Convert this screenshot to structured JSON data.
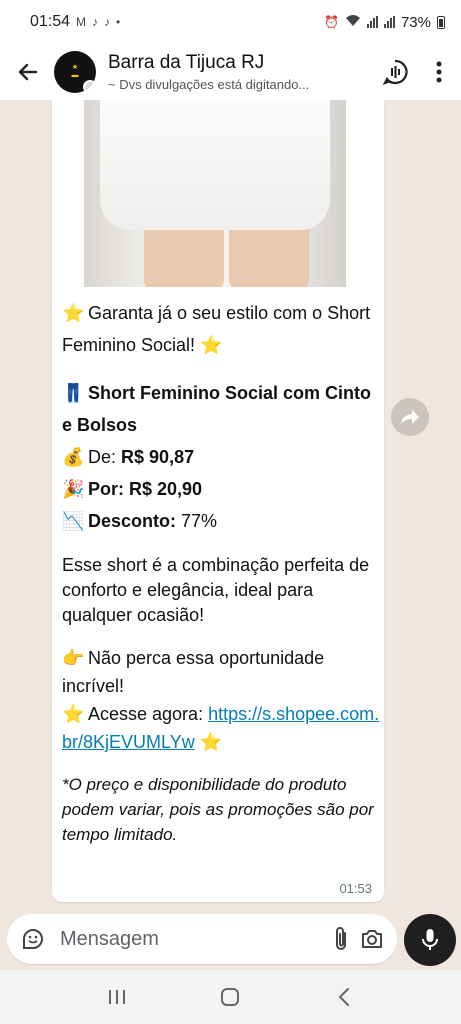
{
  "status_bar": {
    "time": "01:54",
    "battery": "73%",
    "notification_icons": [
      "gmail-icon",
      "tiktok-icon",
      "tiktok-icon",
      "dot-icon"
    ]
  },
  "header": {
    "title": "Barra da Tijuca RJ",
    "subtitle": "~ Dvs divulgações está digitando..."
  },
  "message": {
    "line1": "Garanta já o seu estilo com o Short Feminino Social!",
    "product_name": "Short Feminino Social com Cinto e Bolsos",
    "price_from_label": "De:",
    "price_from_value": "R$ 90,87",
    "price_to": "Por: R$ 20,90",
    "discount_label": "Desconto:",
    "discount_value": "77%",
    "description": "Esse short é a combinação perfeita de conforto e elegância, ideal para qualquer ocasião!",
    "cta": "Não perca essa oportunidade incrível!",
    "access_label": "Acesse agora:",
    "link": "https://s.shopee.com.br/8KjEVUMLYw",
    "disclaimer": "*O preço e disponibilidade do produto podem variar, pois as promoções são por tempo limitado.",
    "time": "01:53"
  },
  "input": {
    "placeholder": "Mensagem"
  },
  "colors": {
    "chat_bg": "#efe7de",
    "link": "#027eb5",
    "bubble": "#ffffff",
    "mic_button": "#1f1f1f"
  }
}
